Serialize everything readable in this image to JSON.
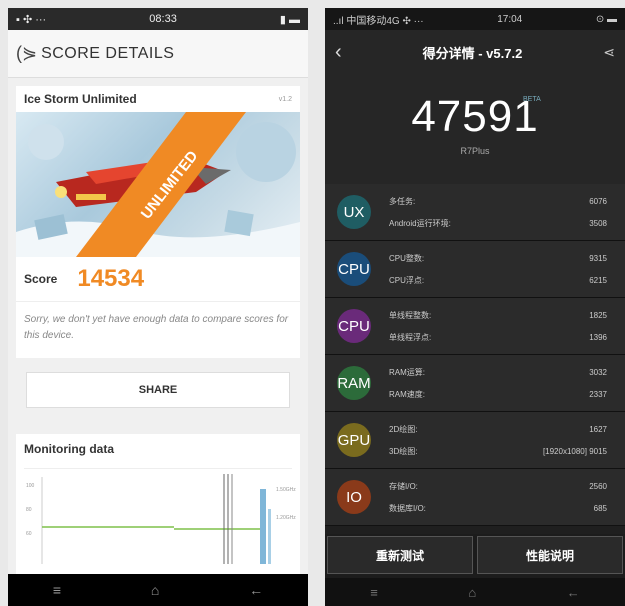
{
  "left": {
    "status": {
      "left": "▪ ✣ ···",
      "time": "08:33",
      "right": "▮ ▬"
    },
    "header": {
      "title": "SCORE DETAILS"
    },
    "test": {
      "name": "Ice Storm Unlimited",
      "version": "v1.2"
    },
    "banner": {
      "ribbon": "UNLIMITED"
    },
    "score": {
      "label": "Score",
      "value": "14534"
    },
    "sorry": "Sorry, we don't yet have enough data to compare scores for this device.",
    "share": "SHARE",
    "monitoring": {
      "title": "Monitoring data",
      "yticks": [
        "100",
        "80",
        "60"
      ],
      "rlabels": [
        "1.50GHz",
        "1.20GHz"
      ]
    },
    "nav": {
      "menu": "≡",
      "home": "⌂",
      "back": "←"
    }
  },
  "right": {
    "status": {
      "left": "..ıl 中国移动4G ✣ ···",
      "time": "17:04",
      "right": "⊙ ▬"
    },
    "title": "得分详情 - v5.7.2",
    "score": "47591",
    "beta": "BETA",
    "model": "R7Plus",
    "categories": [
      {
        "code": "UX",
        "color": "#1f5d63",
        "items": [
          {
            "label": "多任务:",
            "value": "6076"
          },
          {
            "label": "Android运行环境:",
            "value": "3508"
          }
        ]
      },
      {
        "code": "CPU",
        "color": "#1a4d7a",
        "items": [
          {
            "label": "CPU整数:",
            "value": "9315"
          },
          {
            "label": "CPU浮点:",
            "value": "6215"
          }
        ]
      },
      {
        "code": "CPU",
        "color": "#6a2a7a",
        "items": [
          {
            "label": "单线程整数:",
            "value": "1825"
          },
          {
            "label": "单线程浮点:",
            "value": "1396"
          }
        ]
      },
      {
        "code": "RAM",
        "color": "#2c6b3a",
        "items": [
          {
            "label": "RAM运算:",
            "value": "3032"
          },
          {
            "label": "RAM速度:",
            "value": "2337"
          }
        ]
      },
      {
        "code": "GPU",
        "color": "#7a6b1e",
        "items": [
          {
            "label": "2D绘图:",
            "value": "1627"
          },
          {
            "label": "3D绘图:",
            "value": "[1920x1080] 9015"
          }
        ]
      },
      {
        "code": "IO",
        "color": "#8a3a1a",
        "items": [
          {
            "label": "存储I/O:",
            "value": "2560"
          },
          {
            "label": "数据库I/O:",
            "value": "685"
          }
        ]
      }
    ],
    "buttons": {
      "retest": "重新测试",
      "info": "性能说明"
    },
    "nav": {
      "menu": "≡",
      "home": "⌂",
      "back": "←"
    }
  }
}
